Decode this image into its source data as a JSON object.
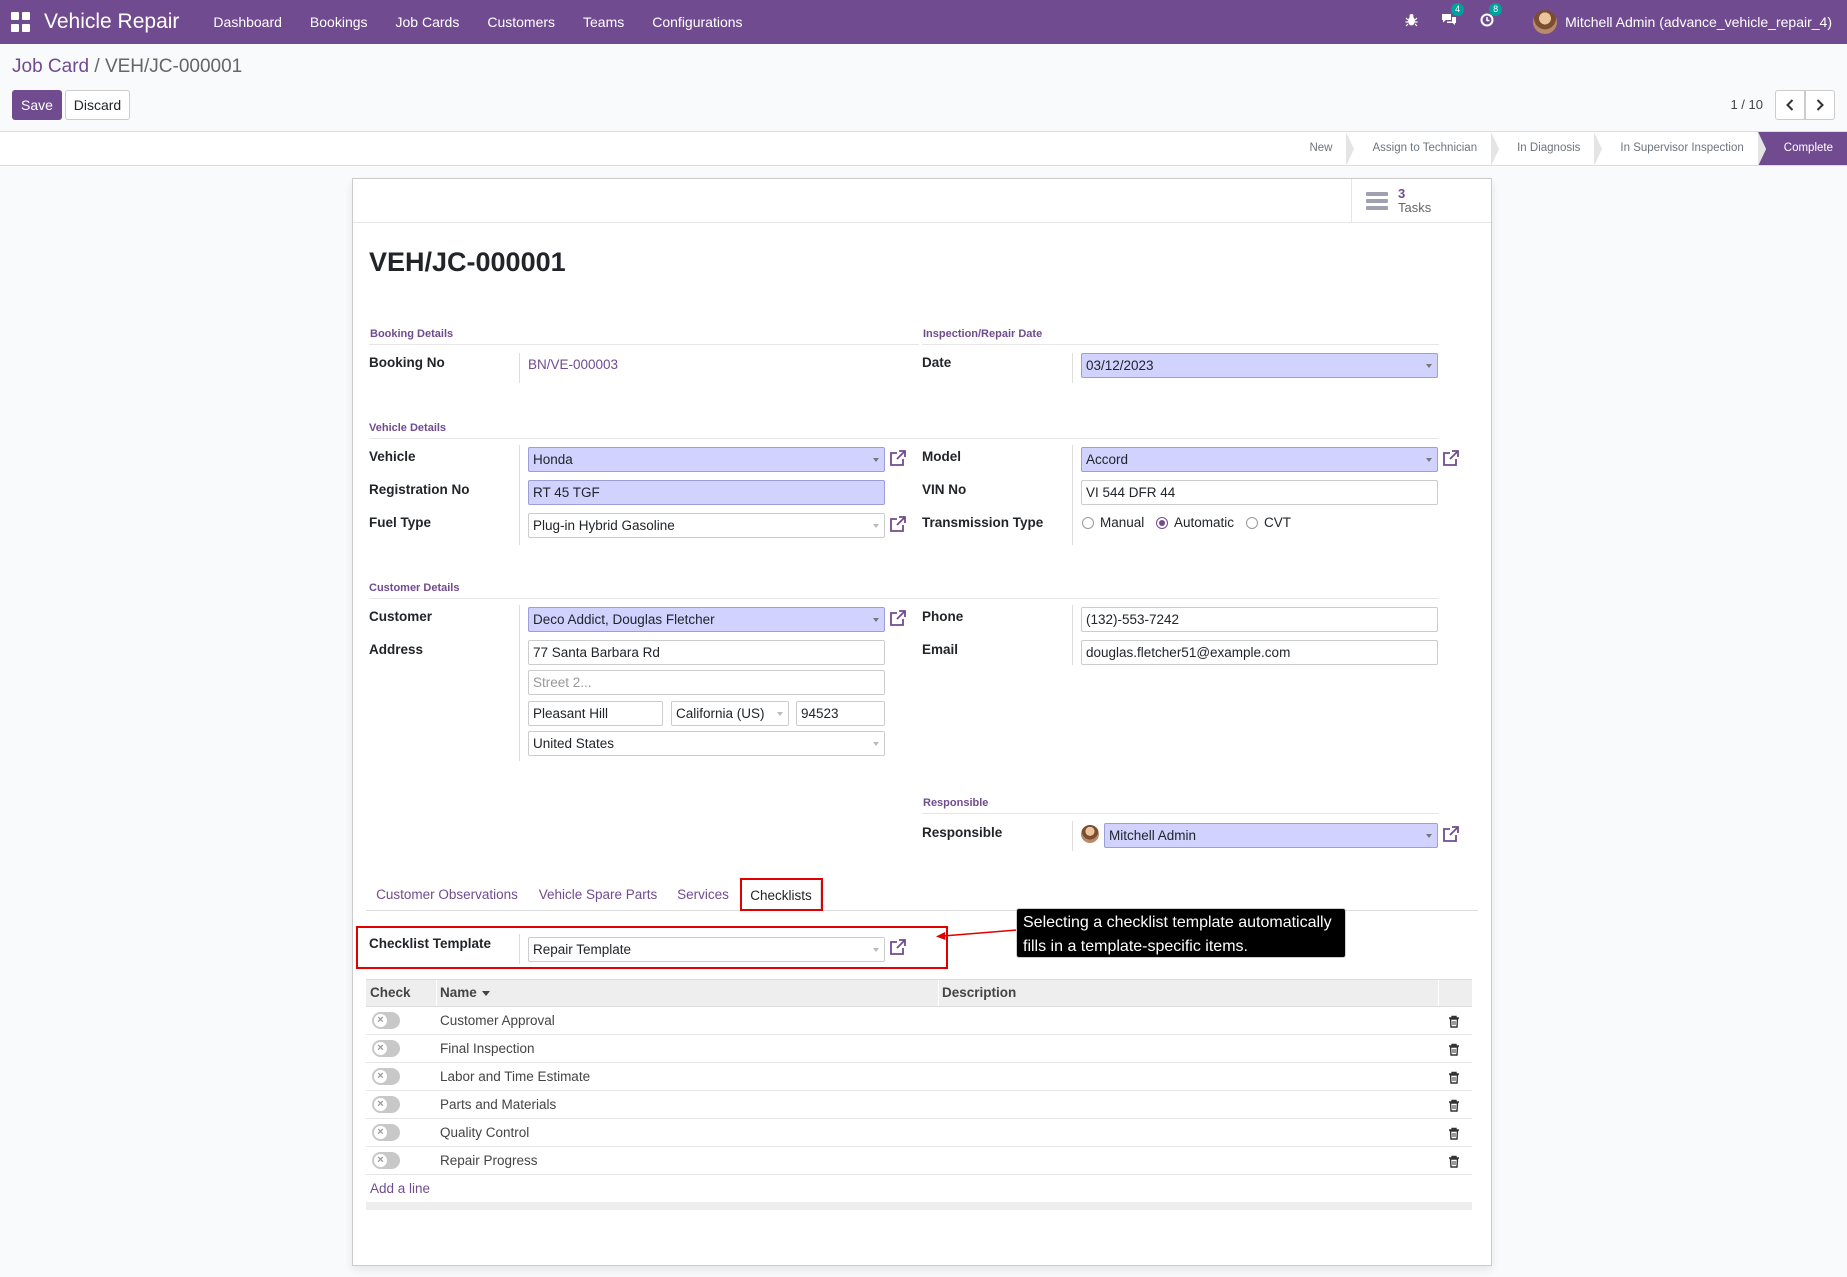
{
  "navbar": {
    "brand": "Vehicle Repair",
    "menu": [
      "Dashboard",
      "Bookings",
      "Job Cards",
      "Customers",
      "Teams",
      "Configurations"
    ],
    "chat_badge": "4",
    "activity_badge": "8",
    "user": "Mitchell Admin (advance_vehicle_repair_4)"
  },
  "breadcrumb": {
    "parent": "Job Card",
    "separator": " / ",
    "current": "VEH/JC-000001"
  },
  "actions": {
    "save": "Save",
    "discard": "Discard"
  },
  "pager": {
    "value": "1 / 10"
  },
  "stages": [
    {
      "label": "New",
      "active": false
    },
    {
      "label": "Assign to Technician",
      "active": false
    },
    {
      "label": "In Diagnosis",
      "active": false
    },
    {
      "label": "In Supervisor Inspection",
      "active": false
    },
    {
      "label": "Complete",
      "active": true
    }
  ],
  "stat_button": {
    "value": "3",
    "label": "Tasks"
  },
  "record": {
    "title": "VEH/JC-000001",
    "booking_section": "Booking Details",
    "booking_no_label": "Booking No",
    "booking_no": "BN/VE-000003",
    "inspection_section": "Inspection/Repair Date",
    "date_label": "Date",
    "date": "03/12/2023",
    "vehicle_section": "Vehicle Details",
    "vehicle_label": "Vehicle",
    "vehicle": "Honda",
    "registration_label": "Registration No",
    "registration": "RT 45 TGF",
    "fuel_label": "Fuel Type",
    "fuel": "Plug-in Hybrid Gasoline",
    "model_label": "Model",
    "model": "Accord",
    "vin_label": "VIN No",
    "vin": "VI 544 DFR 44",
    "transmission_label": "Transmission Type",
    "transmission_options": [
      "Manual",
      "Automatic",
      "CVT"
    ],
    "transmission_selected": "Automatic",
    "customer_section": "Customer Details",
    "customer_label": "Customer",
    "customer": "Deco Addict, Douglas Fletcher",
    "address_label": "Address",
    "street": "77 Santa Barbara Rd",
    "street2_placeholder": "Street 2...",
    "city": "Pleasant Hill",
    "state": "California (US)",
    "zip": "94523",
    "country": "United States",
    "phone_label": "Phone",
    "phone": "(132)-553-7242",
    "email_label": "Email",
    "email": "douglas.fletcher51@example.com",
    "responsible_section": "Responsible",
    "responsible_label": "Responsible",
    "responsible": "Mitchell Admin"
  },
  "tabs": [
    "Customer Observations",
    "Vehicle Spare Parts",
    "Services",
    "Checklists"
  ],
  "active_tab": "Checklists",
  "checklist": {
    "template_label": "Checklist Template",
    "template": "Repair Template",
    "columns": {
      "check": "Check",
      "name": "Name",
      "description": "Description"
    },
    "rows": [
      "Customer Approval",
      "Final Inspection",
      "Labor and Time Estimate",
      "Parts and Materials",
      "Quality Control",
      "Repair Progress"
    ],
    "add_line": "Add a line"
  },
  "annotation": {
    "text": "Selecting a checklist template automatically fills in a template-specific items.",
    "color": "#e00000"
  },
  "colors": {
    "brand": "#714b8f",
    "required_field": "#d2d2ff",
    "annotation": "#e00000"
  }
}
